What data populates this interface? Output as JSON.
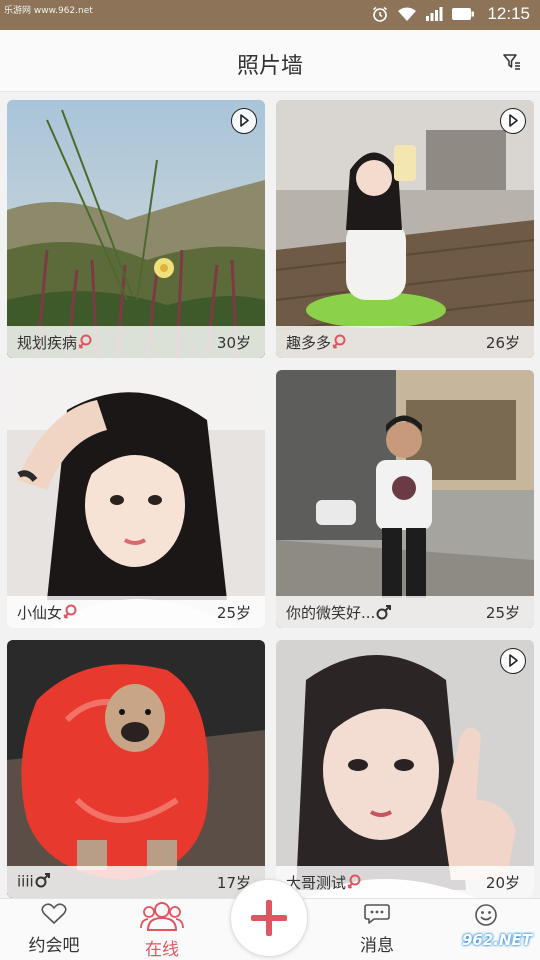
{
  "status_bar": {
    "watermark": "乐游网 www.962.net",
    "time": "12:15",
    "icons": [
      "alarm-icon",
      "wifi-icon",
      "signal-icon",
      "battery-icon"
    ]
  },
  "header": {
    "title": "照片墙",
    "filter_icon": "filter-icon"
  },
  "cards": [
    {
      "name": "规划疾病",
      "gender": "female",
      "age": "30岁",
      "has_video": true
    },
    {
      "name": "趣多多",
      "gender": "female",
      "age": "26岁",
      "has_video": true
    },
    {
      "name": "小仙女",
      "gender": "female",
      "age": "25岁",
      "has_video": false
    },
    {
      "name": "你的微笑好...",
      "gender": "male",
      "age": "25岁",
      "has_video": false
    },
    {
      "name": "iiii",
      "gender": "male",
      "age": "17岁",
      "has_video": false
    },
    {
      "name": "大哥测试",
      "gender": "female",
      "age": "20岁",
      "has_video": true
    }
  ],
  "bottom_nav": {
    "items": [
      {
        "label": "约会吧",
        "icon": "heart-icon",
        "active": false
      },
      {
        "label": "在线",
        "icon": "users-icon",
        "active": true
      },
      {
        "label": "",
        "icon": "plus-icon",
        "active": false
      },
      {
        "label": "消息",
        "icon": "message-icon",
        "active": false
      },
      {
        "label": "",
        "icon": "smiley-icon",
        "active": false
      }
    ],
    "watermark": "962.NET"
  },
  "colors": {
    "status_bar": "#8d7458",
    "accent": "#e05560",
    "female": "#e05560",
    "male": "#333333"
  }
}
